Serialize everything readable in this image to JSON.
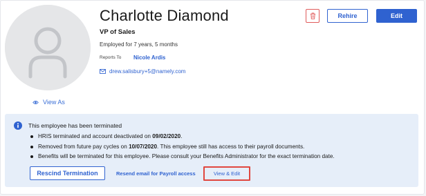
{
  "profile": {
    "name": "Charlotte Diamond",
    "title": "VP of Sales",
    "tenure": "Employed for 7 years, 5 months",
    "reports_to_label": "Reports To",
    "reports_to_name": "Nicole Ardis",
    "email": "drew.salisbury+5@namely.com",
    "view_as_label": "View As"
  },
  "actions": {
    "rehire_label": "Rehire",
    "edit_label": "Edit",
    "delete_icon": "trash-icon"
  },
  "termination_notice": {
    "title": "This employee has been terminated",
    "items": [
      {
        "prefix": "HRIS terminated and account deactivated on ",
        "bold": "09/02/2020",
        "suffix": "."
      },
      {
        "prefix": "Removed from future pay cycles on ",
        "bold": "10/07/2020",
        "suffix": ". This employee still has access to their payroll documents."
      },
      {
        "prefix": "Benefits will be terminated for this employee. Please consult your Benefits Administrator for the exact termination date.",
        "bold": "",
        "suffix": ""
      }
    ],
    "rescind_label": "Rescind Termination",
    "resend_label": "Resend email for Payroll access",
    "view_edit_label": "View & Edit"
  },
  "colors": {
    "accent": "#2f62d0",
    "danger": "#e05a5a",
    "notice_bg": "#e6eef9",
    "highlight": "#e0463e"
  }
}
